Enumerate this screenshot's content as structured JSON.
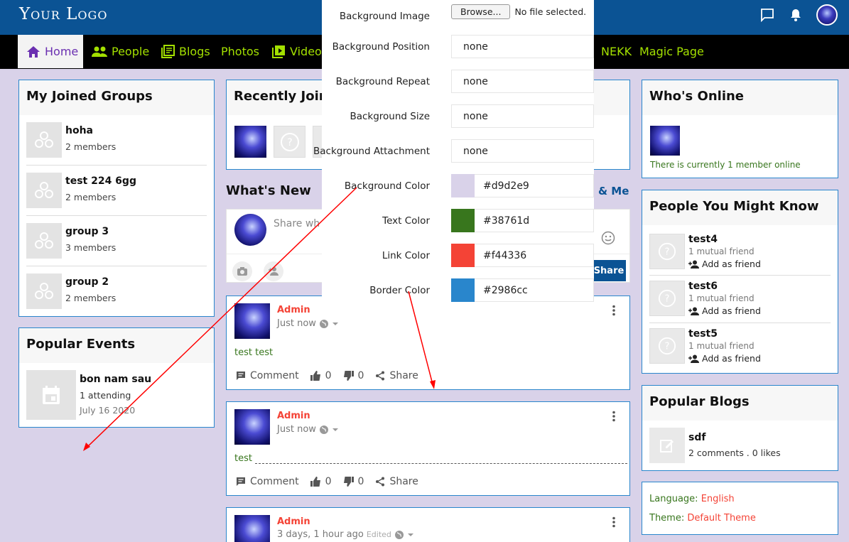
{
  "header": {
    "logo": "Your Logo",
    "icons": [
      "chat-icon",
      "bell-icon",
      "avatar"
    ]
  },
  "nav": {
    "items": [
      {
        "label": "Home",
        "icon": "home-icon",
        "active": true
      },
      {
        "label": "People",
        "icon": "people-icon"
      },
      {
        "label": "Blogs",
        "icon": "blogs-icon"
      },
      {
        "label": "Photos"
      },
      {
        "label": "Videos",
        "icon": "video-icon"
      },
      {
        "label": "NEKK"
      },
      {
        "label": "Magic Page"
      }
    ]
  },
  "joined_groups": {
    "title": "My Joined Groups",
    "items": [
      {
        "name": "hoha",
        "members": "2 members"
      },
      {
        "name": "test 224 6gg",
        "members": "2 members"
      },
      {
        "name": "group 3",
        "members": "3 members"
      },
      {
        "name": "group 2",
        "members": "2 members"
      }
    ]
  },
  "events": {
    "title": "Popular Events",
    "item": {
      "name": "bon nam sau",
      "attending": "1 attending",
      "date": "July 16 2020"
    }
  },
  "recent": {
    "title": "Recently Joine"
  },
  "whats_new": {
    "title": "What's New",
    "tab_right": "g & Me",
    "placeholder": "Share wh",
    "share_button": "Share"
  },
  "posts": [
    {
      "author": "Admin",
      "time": "Just now",
      "text": "test test",
      "comment": "Comment",
      "likes": "0",
      "dislikes": "0",
      "share": "Share"
    },
    {
      "author": "Admin",
      "time": "Just now",
      "text": "test",
      "comment": "Comment",
      "likes": "0",
      "dislikes": "0",
      "share": "Share"
    },
    {
      "author": "Admin",
      "time": "3 days, 1 hour ago",
      "edited": "Edited"
    }
  ],
  "online": {
    "title": "Who's Online",
    "text": "There is currently 1 member online"
  },
  "people": {
    "title": "People You Might Know",
    "items": [
      {
        "name": "test4",
        "mutual": "1 mutual friend",
        "add": "Add as friend"
      },
      {
        "name": "test6",
        "mutual": "1 mutual friend",
        "add": "Add as friend"
      },
      {
        "name": "test5",
        "mutual": "1 mutual friend",
        "add": "Add as friend"
      }
    ]
  },
  "blogs": {
    "title": "Popular Blogs",
    "item": {
      "name": "sdf",
      "meta": "2 comments . 0 likes"
    }
  },
  "settings": {
    "language_label": "Language:",
    "language": "English",
    "theme_label": "Theme:",
    "theme": "Default Theme"
  },
  "style_panel": {
    "bg_image_label": "Background Image",
    "browse": "Browse...",
    "no_file": "No file selected.",
    "rows": [
      {
        "label": "Background Position",
        "value": "none"
      },
      {
        "label": "Background Repeat",
        "value": "none"
      },
      {
        "label": "Background Size",
        "value": "none"
      },
      {
        "label": "Background Attachment",
        "value": "none"
      }
    ],
    "colors": [
      {
        "label": "Background Color",
        "value": "#d9d2e9"
      },
      {
        "label": "Text Color",
        "value": "#38761d"
      },
      {
        "label": "Link Color",
        "value": "#f44336"
      },
      {
        "label": "Border Color",
        "value": "#2986cc"
      }
    ]
  },
  "colors": {
    "header": "#0b5394",
    "accent_green": "#a3e000",
    "link": "#f44336",
    "text": "#38761d",
    "border": "#2986cc",
    "background": "#d9d2e9"
  }
}
